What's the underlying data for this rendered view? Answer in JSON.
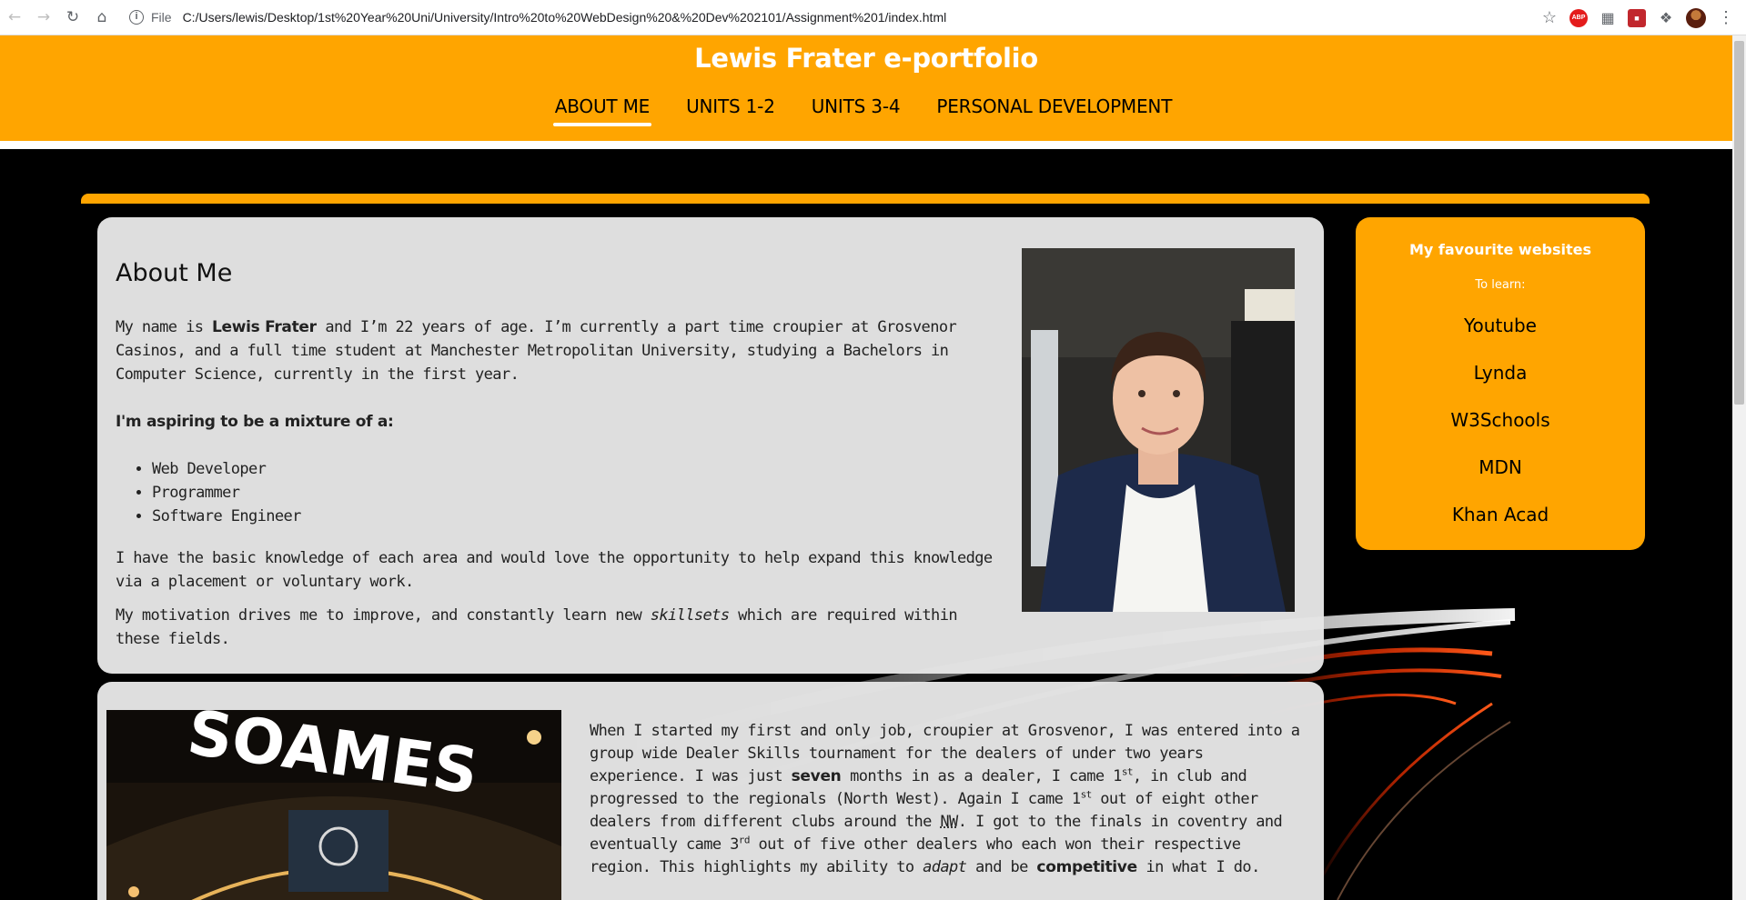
{
  "browser": {
    "back_icon": "arrow-left-icon",
    "forward_icon": "arrow-right-icon",
    "reload_icon": "reload-icon",
    "home_icon": "home-icon",
    "file_label": "File",
    "url": "C:/Users/lewis/Desktop/1st%20Year%20Uni/University/Intro%20to%20WebDesign%20&%20Dev%202101/Assignment%201/index.html",
    "abp_label": "ABP"
  },
  "header": {
    "title": "Lewis Frater e-portfolio",
    "nav": [
      "ABOUT ME",
      "UNITS 1-2",
      "UNITS 3-4",
      "PERSONAL DEVELOPMENT"
    ],
    "active": "ABOUT ME"
  },
  "about": {
    "heading": "About Me",
    "p1_a": "My name is ",
    "p1_name": "Lewis Frater",
    "p1_b": " and I’m 22 years of age. I’m currently a part time croupier at Grosvenor Casinos, and a full time student at Manchester Metropolitan University, studying a Bachelors in Computer Science, currently in the first year.",
    "aspire": "I'm aspiring to be a mixture of a:",
    "roles": [
      "Web Developer",
      "Programmer",
      "Software Engineer"
    ],
    "p3": "I have the basic knowledge of each area and would love the opportunity to help expand this knowledge via a placement or voluntary work.",
    "p4_a": "My motivation drives me to improve, and constantly learn new ",
    "p4_em": "skillsets",
    "p4_b": " which are required within these fields."
  },
  "sidebar": {
    "title": "My favourite websites",
    "subtitle": "To learn:",
    "links": [
      "Youtube",
      "Lynda",
      "W3Schools",
      "MDN",
      "Khan Acad"
    ]
  },
  "section2": {
    "image_text": "SOAMES",
    "t1": "When I started my first and only job, croupier at Grosvenor, I was entered into a group wide Dealer Skills tournament for the dealers of under two years experience. I was just ",
    "b1": "seven",
    "t2": " months in as a dealer, I came 1",
    "sup1": "st",
    "t3": ", in club and progressed to the regionals (North West). Again I came 1",
    "sup2": "st",
    "t4": " out of eight other dealers from different clubs around the ",
    "abbr": "NW",
    "t5": ". I got to the finals in coventry and eventually came 3",
    "sup3": "rd",
    "t6": " out of five other dealers who each won their respective region. This highlights my ability to ",
    "em1": "adapt",
    "t7": " and be ",
    "b2": "competitive",
    "t8": " in what I do."
  },
  "colors": {
    "brand_orange": "#ffa500",
    "page_bg": "#000000",
    "card_bg": "#e5e5e5"
  }
}
